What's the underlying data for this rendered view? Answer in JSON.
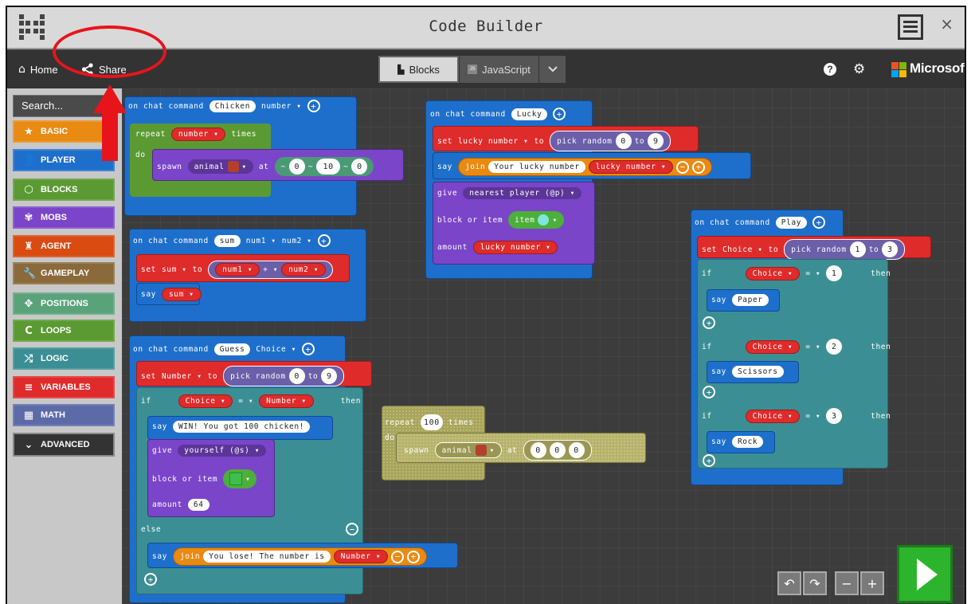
{
  "window": {
    "title": "Code Builder",
    "close_glyph": "×"
  },
  "nav": {
    "home_label": "Home",
    "share_label": "Share",
    "blocks_tab": "Blocks",
    "js_tab": "JavaScript",
    "brand": "Microsoft",
    "help_glyph": "?"
  },
  "toolbox": {
    "search_placeholder": "Search...",
    "categories": [
      {
        "label": "BASIC",
        "icon": "star-icon",
        "glyph": "★",
        "color": "#e98a12"
      },
      {
        "label": "PLAYER",
        "icon": "player-icon",
        "glyph": "👤",
        "color": "#1e6fcc"
      },
      {
        "label": "BLOCKS",
        "icon": "cube-icon",
        "glyph": "⬡",
        "color": "#5b9a32"
      },
      {
        "label": "MOBS",
        "icon": "paw-icon",
        "glyph": "✾",
        "color": "#7a45c9"
      },
      {
        "label": "AGENT",
        "icon": "agent-icon",
        "glyph": "♜",
        "color": "#d94b10"
      },
      {
        "label": "GAMEPLAY",
        "icon": "wrench-icon",
        "glyph": "🔧",
        "color": "#8a6a3a"
      },
      {
        "label": "POSITIONS",
        "icon": "move-icon",
        "glyph": "✥",
        "color": "#5aa37a"
      },
      {
        "label": "LOOPS",
        "icon": "loop-icon",
        "glyph": "C",
        "color": "#5b9a32"
      },
      {
        "label": "LOGIC",
        "icon": "shuffle-icon",
        "glyph": "⤮",
        "color": "#3b8f94"
      },
      {
        "label": "VARIABLES",
        "icon": "menu-icon",
        "glyph": "≡",
        "color": "#e02b2b"
      },
      {
        "label": "MATH",
        "icon": "calculator-icon",
        "glyph": "▦",
        "color": "#5c6ba8"
      },
      {
        "label": "ADVANCED",
        "icon": "chevron-down-icon",
        "glyph": "⌄",
        "color": "#333333"
      }
    ]
  },
  "blocks": {
    "chicken": {
      "head": "on chat command",
      "cmd": "Chicken",
      "param": "number ▾",
      "repeat": "repeat",
      "repeat_var": "number ▾",
      "times": "times",
      "do": "do",
      "spawn": "spawn",
      "animal": "animal",
      "at": "at",
      "tilde": "~",
      "x": "0",
      "y": "10",
      "z": "0"
    },
    "sum": {
      "head": "on chat command",
      "cmd": "sum",
      "p1": "num1 ▾",
      "p2": "num2 ▾",
      "set": "set",
      "var": "sum ▾",
      "to": "to",
      "a": "num1 ▾",
      "op": "+ ▾",
      "b": "num2 ▾",
      "say": "say",
      "say_var": "sum ▾"
    },
    "guess": {
      "head": "on chat command",
      "cmd": "Guess",
      "param": "Choice ▾",
      "set": "set",
      "var": "Number ▾",
      "to": "to",
      "pick": "pick random",
      "lo": "0",
      "lo_to": "to",
      "hi": "9",
      "if": "if",
      "cond_a": "Choice ▾",
      "eq": "= ▾",
      "cond_b": "Number ▾",
      "then": "then",
      "say": "say",
      "win": "WIN! You got 100 chicken!",
      "give": "give",
      "target": "yourself (@s) ▾",
      "block_item": "block or item",
      "amount": "amount",
      "amount_val": "64",
      "else": "else",
      "say2": "say",
      "join": "join",
      "lose": "You lose! The number is",
      "num": "Number ▾"
    },
    "lucky": {
      "head": "on chat command",
      "cmd": "Lucky",
      "set": "set",
      "var": "lucky number ▾",
      "to": "to",
      "pick": "pick random",
      "lo": "0",
      "lo_to": "to",
      "hi": "9",
      "say": "say",
      "join": "join",
      "text": "Your lucky number",
      "num": "lucky number ▾",
      "give": "give",
      "target": "nearest player (@p) ▾",
      "block_item": "block or item",
      "item": "item",
      "amount": "amount",
      "amount_val": "lucky number ▾"
    },
    "loose": {
      "repeat": "repeat",
      "count": "100",
      "times": "times",
      "do": "do",
      "spawn": "spawn",
      "animal": "animal",
      "at": "at",
      "x": "0",
      "y": "0",
      "z": "0"
    },
    "play": {
      "head": "on chat command",
      "cmd": "Play",
      "set": "set",
      "var": "Choice ▾",
      "to": "to",
      "pick": "pick random",
      "lo": "1",
      "lo_to": "to",
      "hi": "3",
      "if": "if",
      "choice": "Choice ▾",
      "eq": "= ▾",
      "then": "then",
      "say": "say",
      "c1": "1",
      "s1": "Paper",
      "c2": "2",
      "s2": "Scissors",
      "c3": "3",
      "s3": "Rock"
    }
  }
}
